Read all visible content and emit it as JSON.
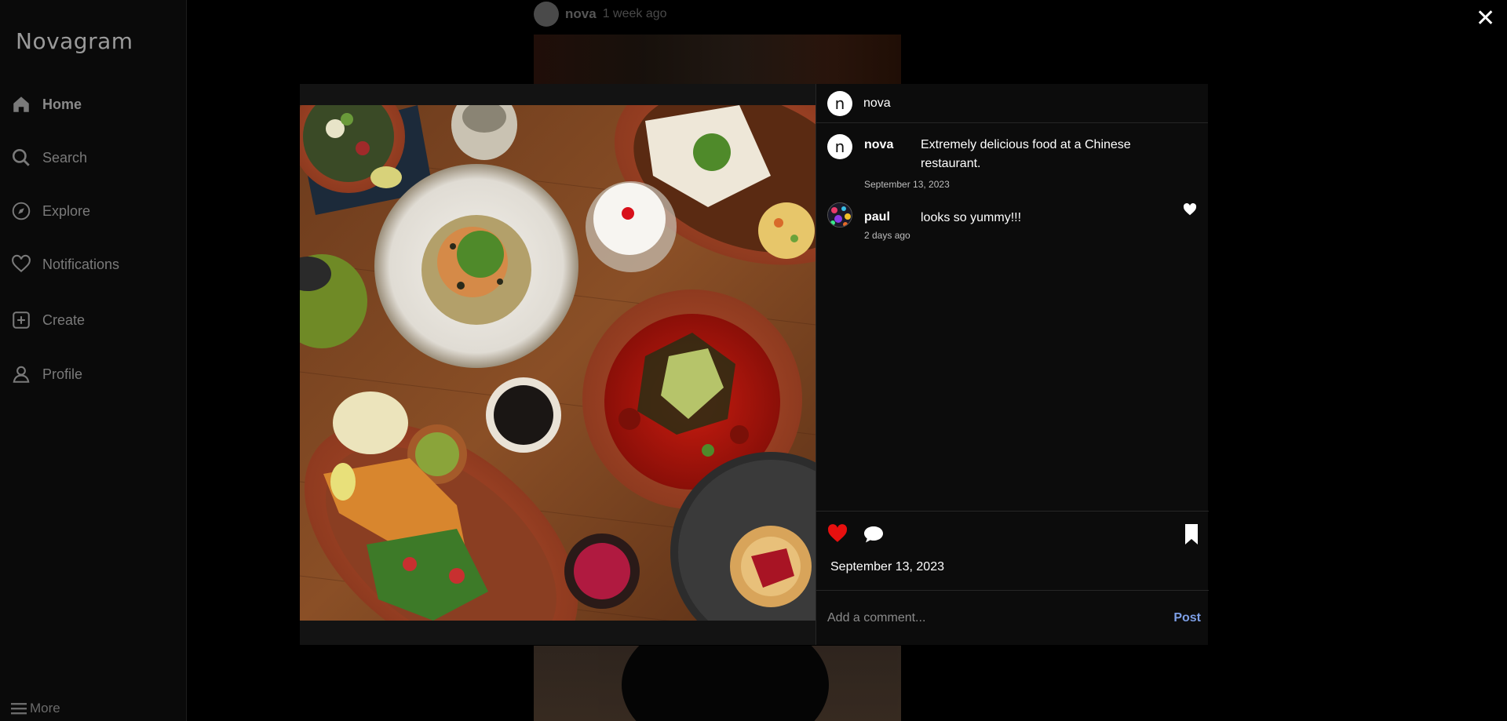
{
  "app": {
    "name": "Novagram"
  },
  "sidebar": {
    "items": [
      {
        "label": "Home",
        "icon": "home-icon"
      },
      {
        "label": "Search",
        "icon": "search-icon"
      },
      {
        "label": "Explore",
        "icon": "compass-icon"
      },
      {
        "label": "Notifications",
        "icon": "heart-icon"
      },
      {
        "label": "Create",
        "icon": "plus-square-icon"
      },
      {
        "label": "Profile",
        "icon": "user-icon"
      }
    ],
    "more_label": "More"
  },
  "feed": {
    "username": "nova",
    "time": "1 week ago"
  },
  "modal": {
    "header": {
      "avatar_letter": "n",
      "username": "nova"
    },
    "comments": [
      {
        "avatar_letter": "n",
        "user": "nova",
        "text": "Extremely delicious food at a Chinese restaurant.",
        "date": "September 13, 2023"
      },
      {
        "user": "paul",
        "text": "looks so yummy!!!",
        "date": "2 days ago",
        "liked": true
      }
    ],
    "post_date": "September 13, 2023",
    "liked": true,
    "saved": true,
    "comment_placeholder": "Add a comment...",
    "post_label": "Post"
  },
  "colors": {
    "like_red": "#e8100f",
    "post_blue": "#7d9fe6"
  },
  "close_label": "✕"
}
